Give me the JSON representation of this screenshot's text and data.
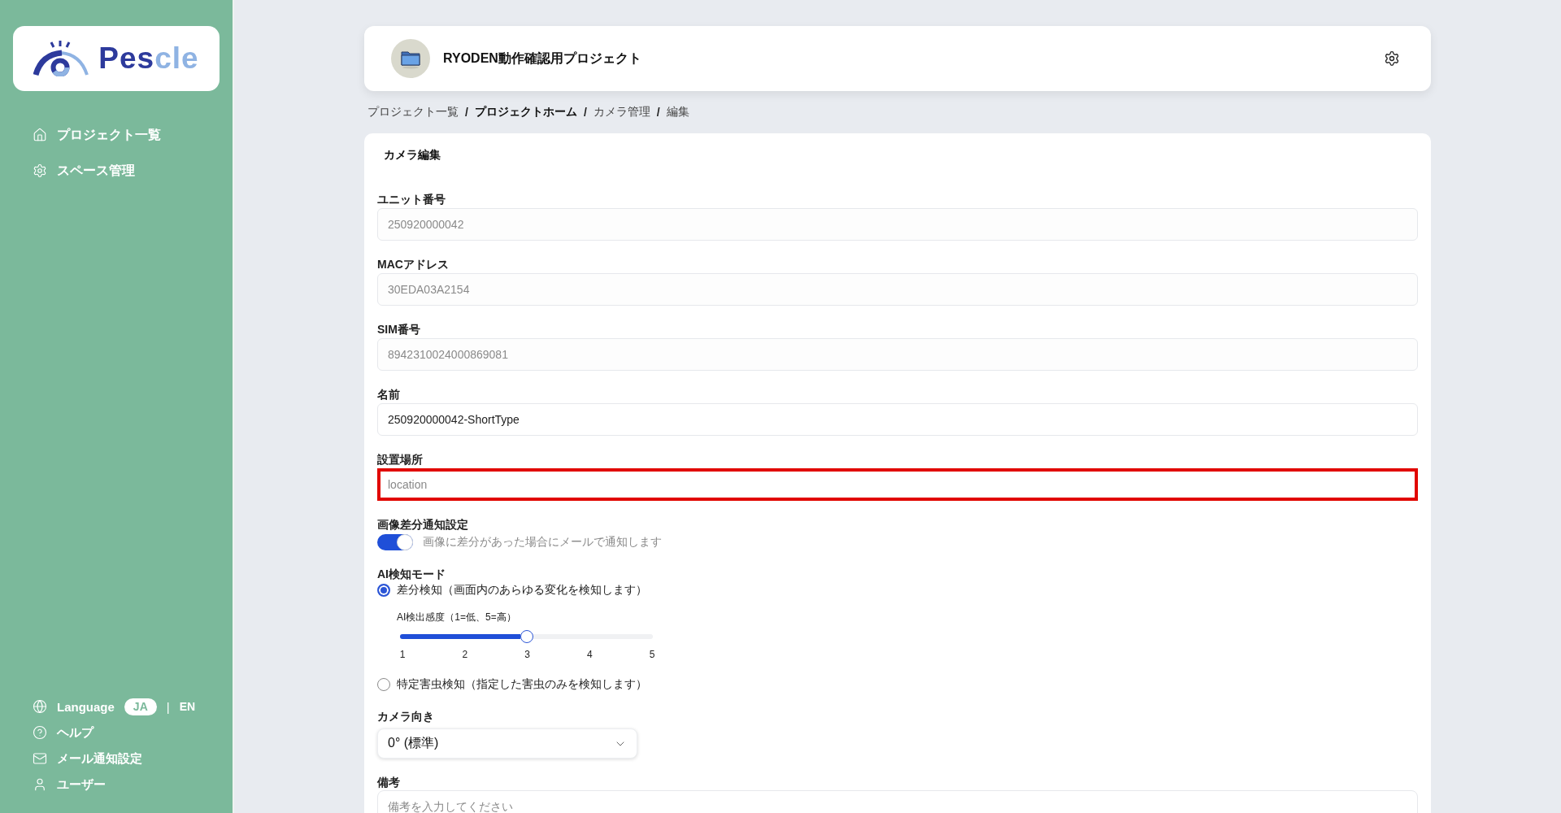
{
  "sidebar": {
    "logo": {
      "wordmark": [
        {
          "text": "Pes",
          "color": "#2d3a9c"
        },
        {
          "text": "cle",
          "color": "#8fb3e3"
        }
      ]
    },
    "nav": [
      {
        "label": "プロジェクト一覧"
      },
      {
        "label": "スペース管理"
      }
    ],
    "language": {
      "label": "Language",
      "separator": "|",
      "options": [
        {
          "label": "JA",
          "selected": true
        },
        {
          "label": "EN",
          "selected": false
        }
      ]
    },
    "footer_links": [
      {
        "label": "ヘルプ"
      },
      {
        "label": "メール通知設定"
      },
      {
        "label": "ユーザー"
      }
    ]
  },
  "header": {
    "title": "RYODEN動作確認用プロジェクト"
  },
  "breadcrumb": [
    {
      "label": "プロジェクト一覧",
      "bold": false
    },
    {
      "separator": "/",
      "label": "プロジェクトホーム",
      "bold": true
    },
    {
      "separator": "/",
      "label": "カメラ管理",
      "bold": false
    },
    {
      "separator": "/",
      "label": "編集",
      "bold": false
    }
  ],
  "form": {
    "title": "カメラ編集",
    "fields": [
      {
        "kind": "text",
        "label": "ユニット番号",
        "value": "250920000042",
        "disabled": true,
        "highlighted": false
      },
      {
        "kind": "text",
        "label": "MACアドレス",
        "value": "30EDA03A2154",
        "disabled": true,
        "highlighted": false
      },
      {
        "kind": "text",
        "label": "SIM番号",
        "value": "8942310024000869081",
        "disabled": true,
        "highlighted": false
      },
      {
        "kind": "text",
        "label": "名前",
        "value": "250920000042-ShortType",
        "disabled": false,
        "highlighted": false
      },
      {
        "kind": "text",
        "label": "設置場所",
        "placeholder": "location",
        "disabled": false,
        "highlighted": true
      },
      {
        "kind": "toggle",
        "label": "画像差分通知設定",
        "on": true,
        "description": "画像に差分があった場合にメールで通知します"
      },
      {
        "kind": "radio_group",
        "label": "AI検知モード",
        "options": [
          {
            "label": "差分検知（画面内のあらゆる変化を検知します）",
            "selected": true,
            "slider": {
              "label": "AI検出感度（1=低、5=高）",
              "level": 0.5,
              "ticks": [
                "1",
                "2",
                "3",
                "4",
                "5"
              ]
            }
          },
          {
            "label": "特定害虫検知（指定した害虫のみを検知します）",
            "selected": false
          }
        ]
      },
      {
        "kind": "select",
        "label": "カメラ向き",
        "value": "0° (標準)"
      },
      {
        "kind": "textarea",
        "label": "備考",
        "placeholder": "備考を入力してください"
      }
    ]
  }
}
